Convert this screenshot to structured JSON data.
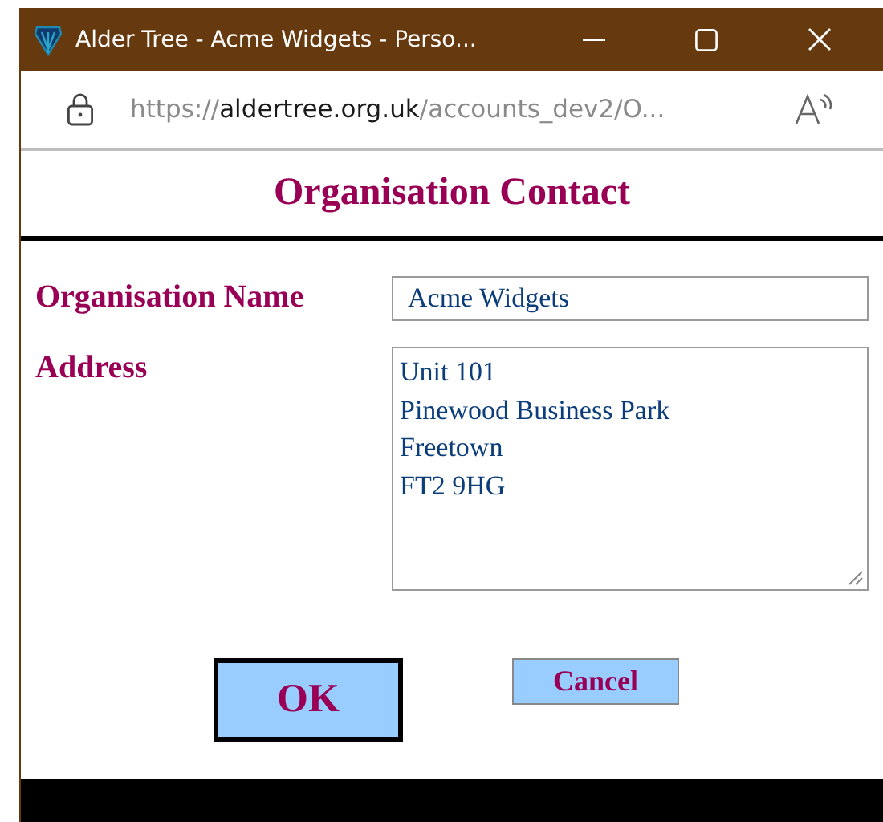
{
  "window": {
    "title": "Alder Tree - Acme Widgets - Perso..."
  },
  "address_bar": {
    "scheme": "https://",
    "host": "aldertree.org.uk",
    "path": "/accounts_dev2/O..."
  },
  "heading": "Organisation Contact",
  "fields": [
    {
      "label": "Organisation Name",
      "kind": "input",
      "value": "Acme Widgets"
    },
    {
      "label": "Address",
      "kind": "textarea",
      "value": "Unit 101\nPinewood Business Park\nFreetown\nFT2 9HG"
    }
  ],
  "buttons": [
    {
      "label": "OK",
      "default": true
    },
    {
      "label": "Cancel",
      "default": false
    }
  ]
}
